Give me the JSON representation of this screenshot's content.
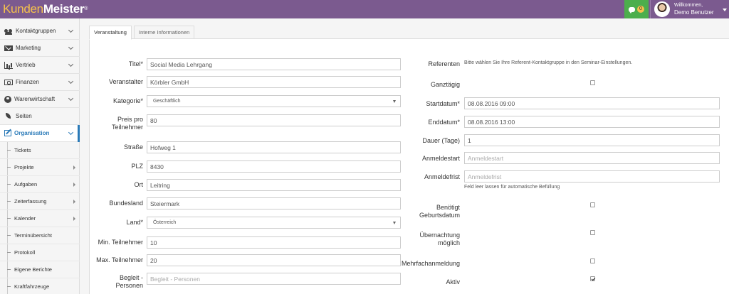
{
  "app": {
    "logo_part1": "Kunden",
    "logo_part2": "Meister",
    "logo_reg": "®",
    "chat_count": "0",
    "welcome": "Willkommen,",
    "user_name": "Demo Benutzer"
  },
  "sidebar": {
    "items": [
      {
        "label": "Kontaktgruppen",
        "icon": "users-icon"
      },
      {
        "label": "Marketing",
        "icon": "mail-icon"
      },
      {
        "label": "Vertrieb",
        "icon": "bar-chart-icon"
      },
      {
        "label": "Finanzen",
        "icon": "money-icon"
      },
      {
        "label": "Warenwirtschaft",
        "icon": "globe-icon"
      },
      {
        "label": "Seiten",
        "icon": "leaf-icon"
      },
      {
        "label": "Organisation",
        "icon": "edit-icon"
      }
    ],
    "sub_items": [
      {
        "label": "Tickets",
        "arrow": false
      },
      {
        "label": "Projekte",
        "arrow": true
      },
      {
        "label": "Aufgaben",
        "arrow": true
      },
      {
        "label": "Zeiterfassung",
        "arrow": true
      },
      {
        "label": "Kalender",
        "arrow": true
      },
      {
        "label": "Terminübersicht",
        "arrow": false
      },
      {
        "label": "Protokoll",
        "arrow": false
      },
      {
        "label": "Eigene Berichte",
        "arrow": false
      },
      {
        "label": "Kraftfahrzeuge",
        "arrow": false
      }
    ]
  },
  "tabs": [
    "Veranstaltung",
    "Interne Informationen"
  ],
  "form_left": {
    "titel_label": "Titel*",
    "titel_value": "Social Media Lehrgang",
    "veranstalter_label": "Veranstalter",
    "veranstalter_value": "Körbler GmbH",
    "kategorie_label": "Kategorie*",
    "kategorie_value": "Geschäftlich",
    "preis_label1": "Preis pro",
    "preis_label2": "Teilnehmer",
    "preis_value": "80",
    "strasse_label": "Straße",
    "strasse_value": "Hofweg 1",
    "plz_label": "PLZ",
    "plz_value": "8430",
    "ort_label": "Ort",
    "ort_value": "Leitring",
    "bundesland_label": "Bundesland",
    "bundesland_value": "Steiermark",
    "land_label": "Land*",
    "land_value": "Österreich",
    "min_label": "Min. Teilnehmer",
    "min_value": "10",
    "max_label": "Max. Teilnehmer",
    "max_value": "20",
    "begleit_label1": "Begleit -",
    "begleit_label2": "Personen",
    "begleit_placeholder": "Begleit - Personen"
  },
  "form_right": {
    "referenten_label": "Referenten",
    "referenten_hint": "Bitte wählen Sie Ihre Referent-Kontaktgruppe in den Seminar-Einstellungen.",
    "ganztaegig_label": "Ganztägig",
    "ganztaegig_checked": false,
    "startdatum_label": "Startdatum*",
    "startdatum_value": "08.08.2016 09:00",
    "enddatum_label": "Enddatum*",
    "enddatum_value": "08.08.2016 13:00",
    "dauer_label": "Dauer (Tage)",
    "dauer_value": "1",
    "anmeldestart_label": "Anmeldestart",
    "anmeldestart_placeholder": "Anmeldestart",
    "anmeldefrist_label": "Anmeldefrist",
    "anmeldefrist_placeholder": "Anmeldefrist",
    "anmeldefrist_help": "Feld leer lassen für automatische Befüllung",
    "geburtsdatum_label1": "Benötigt",
    "geburtsdatum_label2": "Geburtsdatum",
    "geburtsdatum_checked": false,
    "uebernachtung_label1": "Übernachtung",
    "uebernachtung_label2": "möglich",
    "uebernachtung_checked": false,
    "mehrfach_label": "Mehrfachanmeldung",
    "mehrfach_checked": false,
    "aktiv_label": "Aktiv",
    "aktiv_checked": true
  },
  "colors": {
    "topbar": "#7b5a8f",
    "accent": "#2a7ab8",
    "chat": "#4cae4c",
    "logo_yellow": "#f4c04c"
  }
}
